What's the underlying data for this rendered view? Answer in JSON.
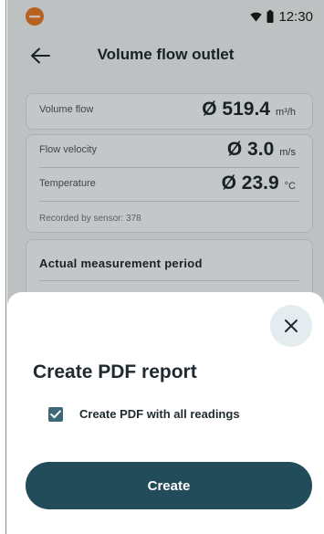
{
  "colors": {
    "background": "#eef2f3",
    "primary": "#234c5a",
    "checkbox": "#3d6977",
    "logo": "#e67b2a",
    "scrim": "rgba(0,0,0,0.20)"
  },
  "status_bar": {
    "app_icon": "testo-logo-icon",
    "time": "12:30",
    "icons": [
      "wifi-icon",
      "battery-icon"
    ]
  },
  "header": {
    "back_icon": "arrow-left-icon",
    "title": "Volume flow outlet"
  },
  "measurements": {
    "volume_flow": {
      "label": "Volume flow",
      "value": "Ø 519.4",
      "unit": "m³/h"
    },
    "flow_velocity": {
      "label": "Flow velocity",
      "value": "Ø 3.0",
      "unit": "m/s"
    },
    "temperature": {
      "label": "Temperature",
      "value": "Ø 23.9",
      "unit": "°C"
    },
    "recorded_by": "Recorded by sensor: 378"
  },
  "measurement_period": {
    "title": "Actual measurement period"
  },
  "sheet": {
    "close_icon": "close-icon",
    "title": "Create PDF report",
    "checkbox_label": "Create PDF with all readings",
    "checkbox_checked": true,
    "create_button": "Create"
  }
}
